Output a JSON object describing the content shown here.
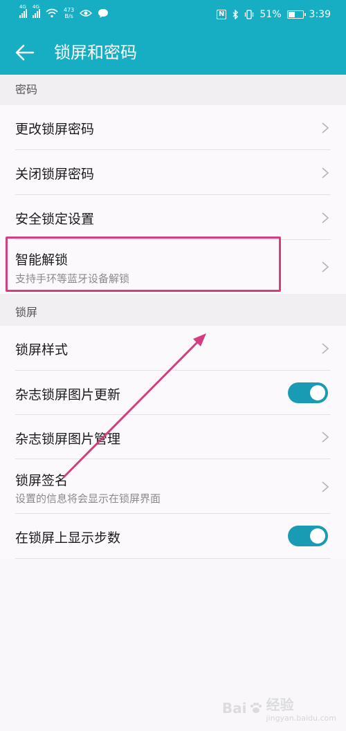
{
  "status_bar": {
    "signal1_label": "4G",
    "signal2_label": "4G",
    "net_speed_value": "473",
    "net_speed_unit": "B/s",
    "nfc_label": "N",
    "battery_percent": "51%",
    "battery_level": 0.51,
    "time": "3:39"
  },
  "app_bar": {
    "title": "锁屏和密码"
  },
  "sections": {
    "password": {
      "header": "密码",
      "items": [
        {
          "title": "更改锁屏密码"
        },
        {
          "title": "关闭锁屏密码"
        },
        {
          "title": "安全锁定设置"
        },
        {
          "title": "智能解锁",
          "subtitle": "支持手环等蓝牙设备解锁"
        }
      ]
    },
    "lockscreen": {
      "header": "锁屏",
      "items": [
        {
          "title": "锁屏样式"
        },
        {
          "title": "杂志锁屏图片更新",
          "toggle_on": true
        },
        {
          "title": "杂志锁屏图片管理"
        },
        {
          "title": "锁屏签名",
          "subtitle": "设置的信息将会显示在锁屏界面"
        },
        {
          "title": "在锁屏上显示步数",
          "toggle_on": true
        }
      ]
    }
  },
  "watermark": {
    "brand": "Bai",
    "brand2": "经验",
    "url": "jingyan.baidu.com"
  },
  "colors": {
    "accent": "#17aec4",
    "toggle": "#1a9bb4",
    "annotation": "#d23e80"
  }
}
